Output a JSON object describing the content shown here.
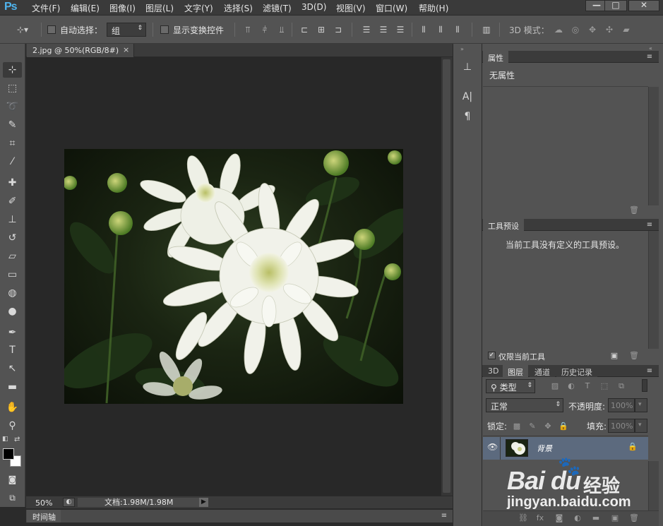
{
  "app": {
    "logo": "Ps"
  },
  "menubar": {
    "items": [
      "文件(F)",
      "编辑(E)",
      "图像(I)",
      "图层(L)",
      "文字(Y)",
      "选择(S)",
      "滤镜(T)",
      "3D(D)",
      "视图(V)",
      "窗口(W)",
      "帮助(H)"
    ]
  },
  "window_controls": {
    "minimize": "—",
    "maximize": "□",
    "close": "✕"
  },
  "options": {
    "auto_select_label": "自动选择：",
    "auto_select_value": "组",
    "show_transform_label": "显示变换控件",
    "mode_3d_label": "3D 模式："
  },
  "document": {
    "tab_title": "2.jpg @ 50%(RGB/8#)",
    "close_glyph": "×",
    "zoom": "50%",
    "doc_info": "文档:1.98M/1.98M"
  },
  "timeline": {
    "label": "时间轴"
  },
  "panels": {
    "properties": {
      "tab": "属性",
      "message": "无属性"
    },
    "tool_presets": {
      "tab": "工具预设",
      "message": "当前工具没有定义的工具预设。",
      "current_tool_only": "仅限当前工具"
    },
    "layers": {
      "tabs": [
        "3D",
        "图层",
        "通道",
        "历史记录"
      ],
      "active_tab": "图层",
      "filter_kind": "类型",
      "blend_mode": "正常",
      "opacity_label": "不透明度:",
      "opacity_value": "100%",
      "lock_label": "锁定:",
      "fill_label": "填充:",
      "fill_value": "100%",
      "layer_name": "背景"
    }
  },
  "watermark": {
    "brand": "Bai du",
    "cn": "经验",
    "url": "jingyan.baidu.com"
  }
}
